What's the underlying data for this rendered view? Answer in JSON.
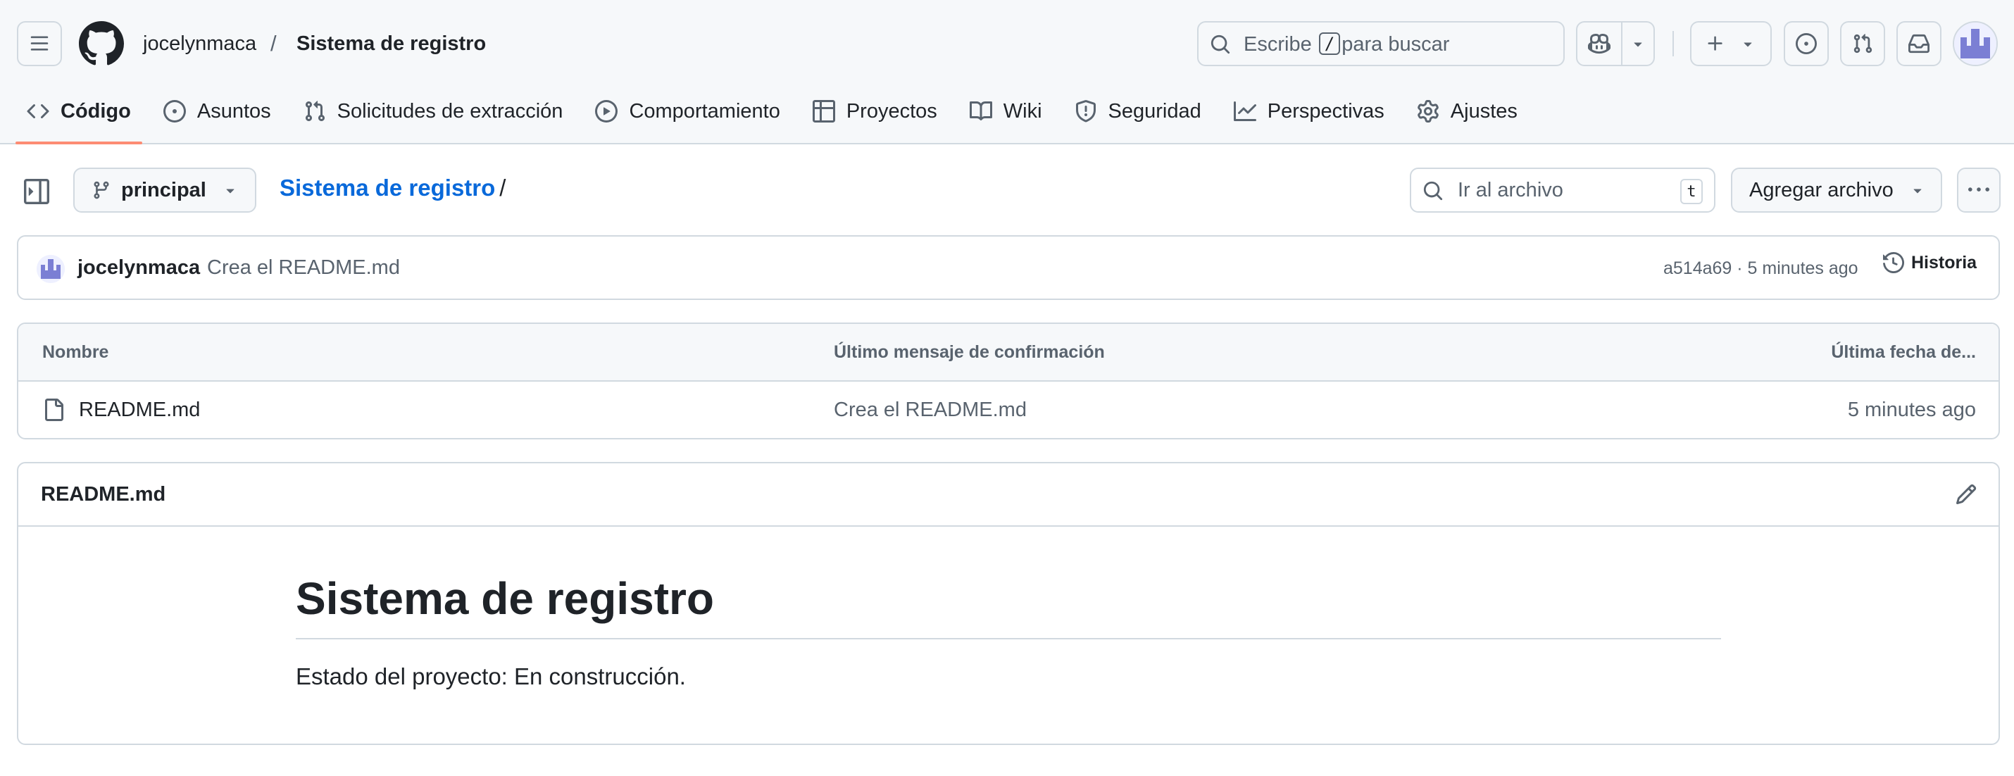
{
  "header": {
    "owner": "jocelynmaca",
    "separator": "/",
    "repo_name": "Sistema de registro",
    "search": {
      "prefix": "Escribe",
      "key": "/",
      "suffix": "para buscar"
    }
  },
  "nav": {
    "tabs": [
      {
        "label": "Código",
        "icon": "code-icon",
        "active": true
      },
      {
        "label": "Asuntos",
        "icon": "issue-icon"
      },
      {
        "label": "Solicitudes de extracción",
        "icon": "pull-request-icon"
      },
      {
        "label": "Comportamiento",
        "icon": "play-icon"
      },
      {
        "label": "Proyectos",
        "icon": "table-icon"
      },
      {
        "label": "Wiki",
        "icon": "book-icon"
      },
      {
        "label": "Seguridad",
        "icon": "shield-icon"
      },
      {
        "label": "Perspectivas",
        "icon": "graph-icon"
      },
      {
        "label": "Ajustes",
        "icon": "gear-icon"
      }
    ]
  },
  "repo_bar": {
    "branch": "principal",
    "path_repo": "Sistema de registro",
    "path_slash": "/",
    "goto_placeholder": "Ir al archivo",
    "goto_key": "t",
    "add_file": "Agregar archivo"
  },
  "commit": {
    "author": "jocelynmaca",
    "message": "Crea el README.md",
    "meta": "a514a69 · 5 minutes ago",
    "history": "Historia"
  },
  "files": {
    "headers": {
      "name": "Nombre",
      "message": "Último mensaje de confirmación",
      "date": "Última fecha de..."
    },
    "rows": [
      {
        "name": "README.md",
        "message": "Crea el README.md",
        "date": "5 minutes ago"
      }
    ]
  },
  "readme": {
    "file_title": "README.md",
    "heading": "Sistema de registro",
    "paragraph": "Estado del proyecto: En construcción."
  },
  "colors": {
    "accent_link": "#0969da",
    "tab_underline": "#fd8c73",
    "border": "#d1d9e0",
    "muted_text": "#59636e"
  }
}
